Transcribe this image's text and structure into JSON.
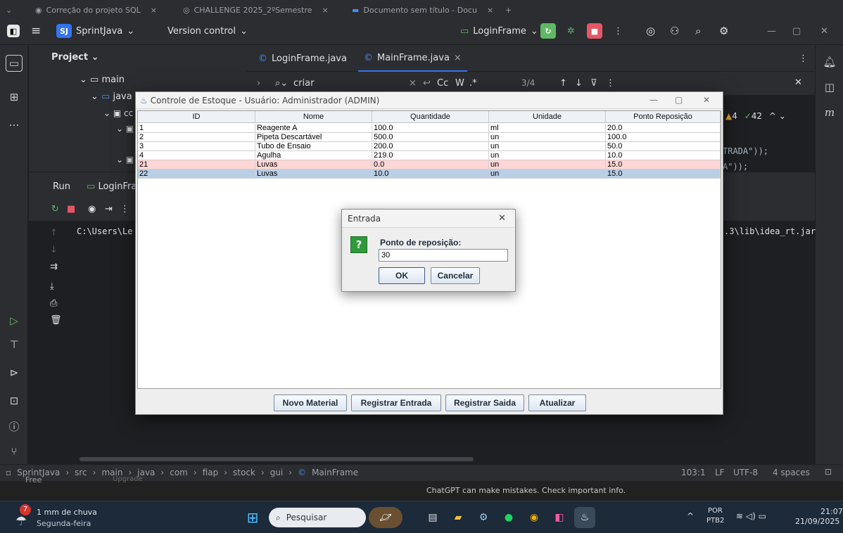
{
  "browser": {
    "tabs": [
      {
        "label": "Correção do projeto SQL",
        "close": "×"
      },
      {
        "label": "CHALLENGE 2025_2ºSemestre",
        "close": "×"
      },
      {
        "label": "Documento sem título - Docu",
        "close": "×"
      }
    ],
    "new_tab": "+"
  },
  "ide": {
    "project_badge": "SJ",
    "project_name": "SprintJava",
    "version_control": "Version control",
    "run_config": "LoginFrame",
    "project_panel_title": "Project",
    "tree": [
      "main",
      "java",
      "cc"
    ],
    "editor_tabs": [
      {
        "label": "LoginFrame.java"
      },
      {
        "label": "MainFrame.java",
        "close": "×"
      }
    ],
    "find": {
      "query": "criar",
      "case": "Cc",
      "word": "W",
      "regex": ".*",
      "match_count": "3/4"
    },
    "inspections": {
      "warnings": "4",
      "ok": "42"
    },
    "code_lines": [
      "TRADA\"));",
      "A\"));"
    ],
    "run_tab_label": "Run",
    "run_config_tab": "LoginFra",
    "console_line_left": "C:\\Users\\Le",
    "console_line_right": ".3\\lib\\idea_rt.jar",
    "breadcrumb": [
      "SprintJava",
      "src",
      "main",
      "java",
      "com",
      "fiap",
      "stock",
      "gui",
      "MainFrame"
    ],
    "status": {
      "position": "103:1",
      "line_sep": "LF",
      "encoding": "UTF-8",
      "indent": "4 spaces"
    }
  },
  "chat_strip": {
    "plan": "Free",
    "upgrade": "Upgrade",
    "disclaimer": "ChatGPT can make mistakes. Check important info."
  },
  "swing": {
    "title": "Controle de Estoque - Usuário: Administrador (ADMIN)",
    "columns": [
      "ID",
      "Nome",
      "Quantidade",
      "Unidade",
      "Ponto Reposição"
    ],
    "rows": [
      [
        "1",
        "Reagente A",
        "100.0",
        "ml",
        "20.0"
      ],
      [
        "2",
        "Pipeta Descartável",
        "500.0",
        "un",
        "100.0"
      ],
      [
        "3",
        "Tubo de Ensaio",
        "200.0",
        "un",
        "50.0"
      ],
      [
        "4",
        "Agulha",
        "219.0",
        "un",
        "10.0"
      ],
      [
        "21",
        "Luvas",
        "0.0",
        "un",
        "15.0"
      ],
      [
        "22",
        "Luvas",
        "10.0",
        "un",
        "15.0"
      ]
    ],
    "buttons": {
      "novo": "Novo Material",
      "entrada": "Registrar Entrada",
      "saida": "Registrar Saida",
      "atualizar": "Atualizar"
    },
    "colors": {
      "low_stock_row": "#ffd6d6",
      "selected_row": "#b8cfe5"
    }
  },
  "dialog": {
    "title": "Entrada",
    "label": "Ponto de reposição:",
    "value": "30",
    "ok": "OK",
    "cancel": "Cancelar",
    "icon_glyph": "?"
  },
  "taskbar": {
    "weather_badge": "7",
    "weather_text": "1 mm de chuva",
    "weather_day": "Segunda-feira",
    "search_placeholder": "Pesquisar",
    "lang_top": "POR",
    "lang_bottom": "PTB2",
    "time": "21:07",
    "date": "21/09/2025"
  },
  "colors": {
    "ide_bg": "#1e1f22",
    "ide_panel": "#2b2d30",
    "accent_blue": "#3574f0",
    "run_green": "#5fb865",
    "stop_red": "#e55765"
  }
}
